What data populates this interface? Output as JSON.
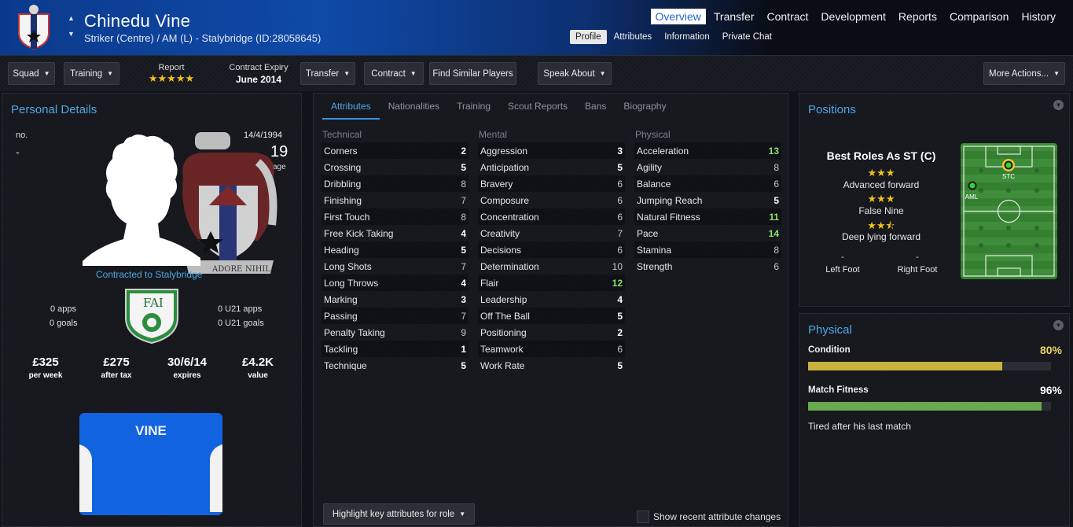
{
  "header": {
    "name": "Chinedu Vine",
    "subtitle": "Striker (Centre) / AM (L) - Stalybridge (ID:28058645)",
    "nav": [
      "Overview",
      "Transfer",
      "Contract",
      "Development",
      "Reports",
      "Comparison",
      "History"
    ],
    "subnav": [
      "Profile",
      "Attributes",
      "Information",
      "Private Chat"
    ]
  },
  "toolbar": {
    "squad": "Squad",
    "training": "Training",
    "report_label": "Report",
    "report_stars": "★★★★★",
    "contract_label": "Contract Expiry",
    "contract_value": "June 2014",
    "transfer": "Transfer",
    "contract": "Contract",
    "find_similar": "Find Similar Players",
    "speak_about": "Speak About",
    "more_actions": "More Actions..."
  },
  "personal": {
    "title": "Personal Details",
    "no_label": "no.",
    "no_value": "-",
    "dob": "14/4/1994",
    "age": "19",
    "age_label": "age",
    "contracted": "Contracted to Stalybridge",
    "apps": "0 apps",
    "goals": "0 goals",
    "u21_apps": "0 U21 apps",
    "u21_goals": "0 U21 goals",
    "fai_text": "FAI",
    "crest_motto": "ADORE",
    "crest_motto2": "NIHIL",
    "money": [
      {
        "big": "£325",
        "small": "per week"
      },
      {
        "big": "£275",
        "small": "after tax"
      },
      {
        "big": "30/6/14",
        "small": "expires"
      },
      {
        "big": "£4.2K",
        "small": "value"
      }
    ],
    "shirt_name": "VINE"
  },
  "attributes": {
    "tabs": [
      "Attributes",
      "Nationalities",
      "Training",
      "Scout Reports",
      "Bans",
      "Biography"
    ],
    "technical_head": "Technical",
    "mental_head": "Mental",
    "physical_head": "Physical",
    "technical": [
      {
        "n": "Corners",
        "v": "2",
        "c": "w"
      },
      {
        "n": "Crossing",
        "v": "5",
        "c": "w"
      },
      {
        "n": "Dribbling",
        "v": "8",
        "c": "g"
      },
      {
        "n": "Finishing",
        "v": "7",
        "c": "g"
      },
      {
        "n": "First Touch",
        "v": "8",
        "c": "g"
      },
      {
        "n": "Free Kick Taking",
        "v": "4",
        "c": "w"
      },
      {
        "n": "Heading",
        "v": "5",
        "c": "w"
      },
      {
        "n": "Long Shots",
        "v": "7",
        "c": "g"
      },
      {
        "n": "Long Throws",
        "v": "4",
        "c": "w"
      },
      {
        "n": "Marking",
        "v": "3",
        "c": "w"
      },
      {
        "n": "Passing",
        "v": "7",
        "c": "g"
      },
      {
        "n": "Penalty Taking",
        "v": "9",
        "c": "g"
      },
      {
        "n": "Tackling",
        "v": "1",
        "c": "w"
      },
      {
        "n": "Technique",
        "v": "5",
        "c": "w"
      }
    ],
    "mental": [
      {
        "n": "Aggression",
        "v": "3",
        "c": "w"
      },
      {
        "n": "Anticipation",
        "v": "5",
        "c": "w"
      },
      {
        "n": "Bravery",
        "v": "6",
        "c": "g"
      },
      {
        "n": "Composure",
        "v": "6",
        "c": "g"
      },
      {
        "n": "Concentration",
        "v": "6",
        "c": "g"
      },
      {
        "n": "Creativity",
        "v": "7",
        "c": "g"
      },
      {
        "n": "Decisions",
        "v": "6",
        "c": "g"
      },
      {
        "n": "Determination",
        "v": "10",
        "c": "g"
      },
      {
        "n": "Flair",
        "v": "12",
        "c": "gr"
      },
      {
        "n": "Leadership",
        "v": "4",
        "c": "w"
      },
      {
        "n": "Off The Ball",
        "v": "5",
        "c": "w"
      },
      {
        "n": "Positioning",
        "v": "2",
        "c": "w"
      },
      {
        "n": "Teamwork",
        "v": "6",
        "c": "g"
      },
      {
        "n": "Work Rate",
        "v": "5",
        "c": "w"
      }
    ],
    "physical": [
      {
        "n": "Acceleration",
        "v": "13",
        "c": "gr"
      },
      {
        "n": "Agility",
        "v": "8",
        "c": "g"
      },
      {
        "n": "Balance",
        "v": "6",
        "c": "g"
      },
      {
        "n": "Jumping Reach",
        "v": "5",
        "c": "w"
      },
      {
        "n": "Natural Fitness",
        "v": "11",
        "c": "gr"
      },
      {
        "n": "Pace",
        "v": "14",
        "c": "gr"
      },
      {
        "n": "Stamina",
        "v": "8",
        "c": "g"
      },
      {
        "n": "Strength",
        "v": "6",
        "c": "g"
      }
    ],
    "highlight_btn": "Highlight key attributes for role",
    "recent_changes": "Show recent attribute changes"
  },
  "positions": {
    "title": "Positions",
    "best_roles": "Best Roles As ST (C)",
    "roles": [
      {
        "stars": "★★★",
        "name": "Advanced forward"
      },
      {
        "stars": "★★★",
        "name": "False Nine"
      },
      {
        "stars": "★★⯪",
        "name": "Deep lying forward"
      }
    ],
    "left_foot_value": "-",
    "left_foot": "Left Foot",
    "right_foot_value": "-",
    "right_foot": "Right Foot",
    "pitch_stc": "STC",
    "pitch_aml": "AML"
  },
  "physical": {
    "title": "Physical",
    "condition_label": "Condition",
    "condition_value": "80%",
    "condition_pct": 80,
    "fitness_label": "Match Fitness",
    "fitness_value": "96%",
    "fitness_pct": 96,
    "note": "Tired after his last match",
    "colors": {
      "condition": "#c9b23c",
      "fitness": "#6aa84f"
    }
  }
}
